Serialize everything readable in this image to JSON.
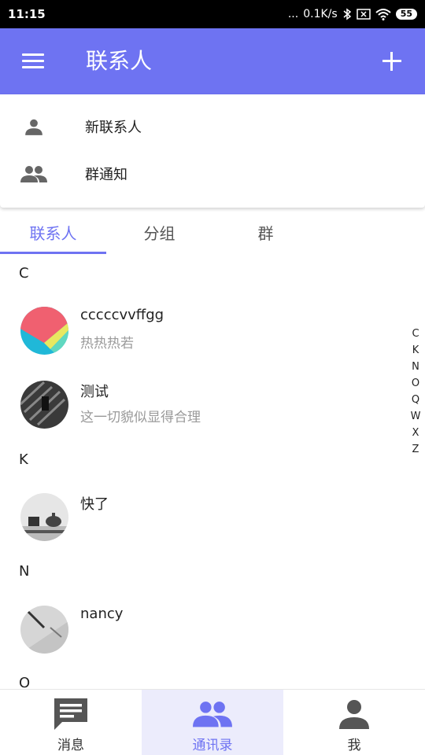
{
  "status_bar": {
    "time": "11:15",
    "network_speed": "0.1K/s",
    "battery": "55",
    "dots": "..."
  },
  "app_bar": {
    "title": "联系人"
  },
  "header_items": [
    {
      "label": "新联系人",
      "icon": "person-icon"
    },
    {
      "label": "群通知",
      "icon": "group-icon"
    }
  ],
  "tabs": [
    {
      "label": "联系人",
      "active": true
    },
    {
      "label": "分组",
      "active": false
    },
    {
      "label": "群",
      "active": false
    }
  ],
  "sections": [
    {
      "letter": "C"
    },
    {
      "letter": "K"
    },
    {
      "letter": "N"
    },
    {
      "letter": "O"
    }
  ],
  "contacts": [
    {
      "name": "cccccvvffgg",
      "status": "热热热若"
    },
    {
      "name": "测试",
      "status": "这一切貌似显得合理"
    },
    {
      "name": "快了",
      "status": ""
    },
    {
      "name": "nancy",
      "status": ""
    }
  ],
  "index_letters": [
    "C",
    "K",
    "N",
    "O",
    "Q",
    "W",
    "X",
    "Z"
  ],
  "bottom_nav": [
    {
      "label": "消息",
      "icon": "message-icon",
      "active": false
    },
    {
      "label": "通讯录",
      "icon": "contacts-icon",
      "active": true
    },
    {
      "label": "我",
      "icon": "profile-icon",
      "active": false
    }
  ],
  "colors": {
    "primary": "#6E73F2",
    "nav_active_bg": "#ECECFC",
    "icon_gray": "#666666"
  }
}
